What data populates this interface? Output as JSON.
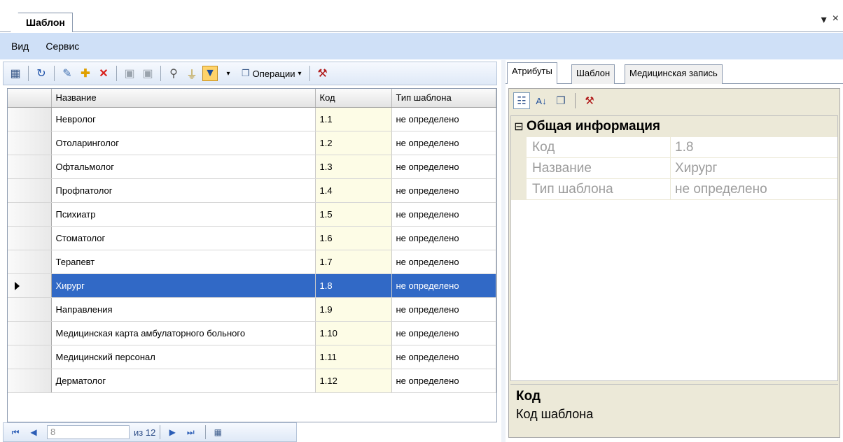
{
  "document_tab": {
    "title": "Шаблон"
  },
  "window": {
    "pin_glyph": "▾",
    "close_glyph": "×"
  },
  "menu": {
    "items": [
      "Вид",
      "Сервис"
    ]
  },
  "toolbar": {
    "operations_label": "Операции"
  },
  "grid": {
    "columns": [
      "Название",
      "Код",
      "Тип шаблона"
    ],
    "rows": [
      {
        "name": "Невролог",
        "code": "1.1",
        "type": "не определено"
      },
      {
        "name": "Отоларинголог",
        "code": "1.2",
        "type": "не определено"
      },
      {
        "name": "Офтальмолог",
        "code": "1.3",
        "type": "не определено"
      },
      {
        "name": "Профпатолог",
        "code": "1.4",
        "type": "не определено"
      },
      {
        "name": "Психиатр",
        "code": "1.5",
        "type": "не определено"
      },
      {
        "name": "Стоматолог",
        "code": "1.6",
        "type": "не определено"
      },
      {
        "name": "Терапевт",
        "code": "1.7",
        "type": "не определено"
      },
      {
        "name": "Хирург",
        "code": "1.8",
        "type": "не определено",
        "selected": true
      },
      {
        "name": "Направления",
        "code": "1.9",
        "type": "не определено"
      },
      {
        "name": "Медицинская карта амбулаторного больного",
        "code": "1.10",
        "type": "не определено"
      },
      {
        "name": "Медицинский персонал",
        "code": "1.11",
        "type": "не определено"
      },
      {
        "name": "Дерматолог",
        "code": "1.12",
        "type": "не определено"
      }
    ]
  },
  "navigator": {
    "position": "8",
    "of_label": "из 12"
  },
  "right_tabs": [
    "Атрибуты",
    "Шаблон",
    "Медицинская запись"
  ],
  "property_grid": {
    "category": "Общая информация",
    "properties": [
      {
        "name": "Код",
        "value": "1.8"
      },
      {
        "name": "Название",
        "value": "Хирург"
      },
      {
        "name": "Тип шаблона",
        "value": "не определено"
      }
    ],
    "help_title": "Код",
    "help_description": "Код шаблона"
  },
  "colors": {
    "menu_bg": "#cfe0f7",
    "selection": "#3169c6",
    "code_cell_bg": "#fdfce6",
    "panel_bg": "#ece9d8"
  }
}
